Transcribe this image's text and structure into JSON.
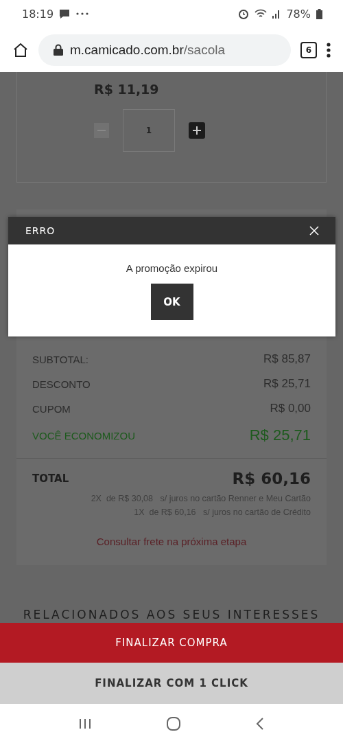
{
  "status_bar": {
    "time": "18:19",
    "battery": "78%"
  },
  "browser": {
    "url_host": "m.camicado.com.br",
    "url_path": "/sacola",
    "tab_count": "6"
  },
  "item": {
    "price": "R$ 11,19",
    "quantity": "1",
    "decrease_disabled": true
  },
  "summary": {
    "rows": [
      {
        "label": "SUBTOTAL:",
        "value": "R$ 85,87",
        "kind": "plain"
      },
      {
        "label": "DESCONTO",
        "value": "R$ 25,71",
        "kind": "plain"
      },
      {
        "label": "CUPOM",
        "value": "R$ 0,00",
        "kind": "plain"
      },
      {
        "label": "VOCÊ ECONOMIZOU",
        "value": "R$ 25,71",
        "kind": "savings"
      }
    ],
    "total_label": "TOTAL",
    "total_value": "R$ 60,16",
    "installments": [
      "2X  de R$ 30,08   s/ juros no cartão Renner e Meu Cartão",
      "1X  de R$ 60,16   s/ juros no cartão de Crédito"
    ],
    "shipping_note": "Consultar frete na próxima etapa"
  },
  "related_heading": "RELACIONADOS AOS SEUS INTERESSES",
  "buttons": [
    {
      "label": "FINALIZAR COMPRA",
      "kind": "primary"
    },
    {
      "label": "FINALIZAR COM 1 CLICK",
      "kind": "secondary"
    }
  ],
  "dialog": {
    "title": "ERRO",
    "message": "A promoção expirou",
    "button": "OK"
  }
}
